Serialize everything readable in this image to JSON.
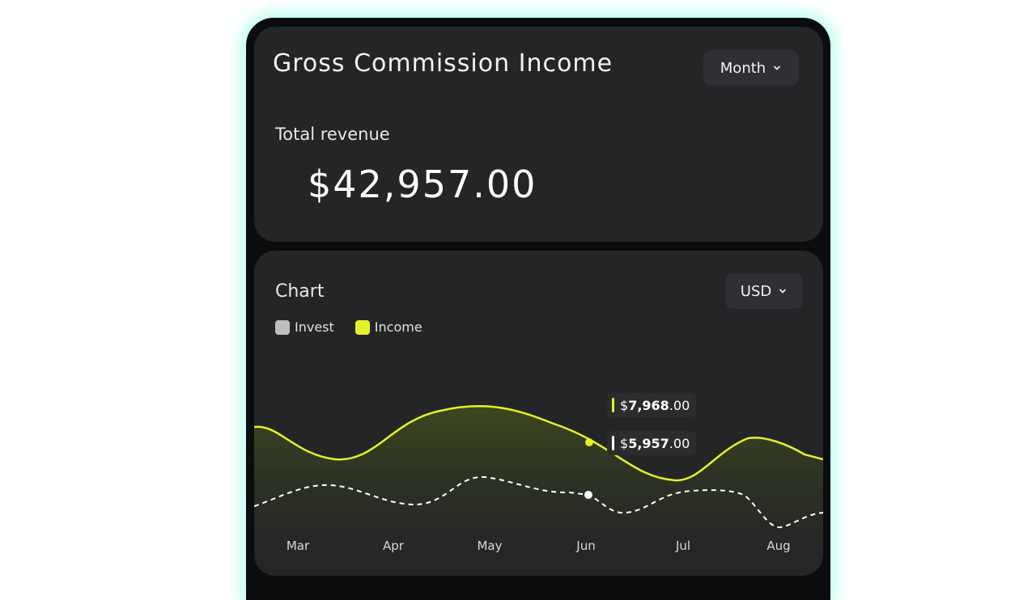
{
  "header": {
    "title": "Gross Commission Income",
    "period_select": "Month"
  },
  "summary": {
    "label": "Total revenue",
    "value": "$42,957.00"
  },
  "chart": {
    "title": "Chart",
    "currency_select": "USD",
    "legend": [
      {
        "label": "Invest",
        "color": "#bdbdbd"
      },
      {
        "label": "Income",
        "color": "#e6f02a"
      }
    ],
    "tooltip_income": {
      "prefix": "$",
      "whole": "7,968",
      "cents": ".00"
    },
    "tooltip_invest": {
      "prefix": "$",
      "whole": "5,957",
      "cents": ".00"
    },
    "colors": {
      "income": "#e6f02a",
      "invest": "#ffffff",
      "fill": "#3d4a1c"
    }
  },
  "chart_data": {
    "type": "area",
    "categories": [
      "Mar",
      "Apr",
      "May",
      "Jun",
      "Jul",
      "Aug"
    ],
    "x_labels": [
      "Mar",
      "Apr",
      "May",
      "Jun",
      "Jul",
      "Aug"
    ],
    "series": [
      {
        "name": "Income",
        "style": "solid-area",
        "color": "#e6f02a"
      },
      {
        "name": "Invest",
        "style": "dashed",
        "color": "#ffffff"
      }
    ],
    "highlight": {
      "x": "Jun",
      "income": 7968.0,
      "invest": 5957.0
    },
    "grid": false,
    "legend_position": "top-left"
  }
}
